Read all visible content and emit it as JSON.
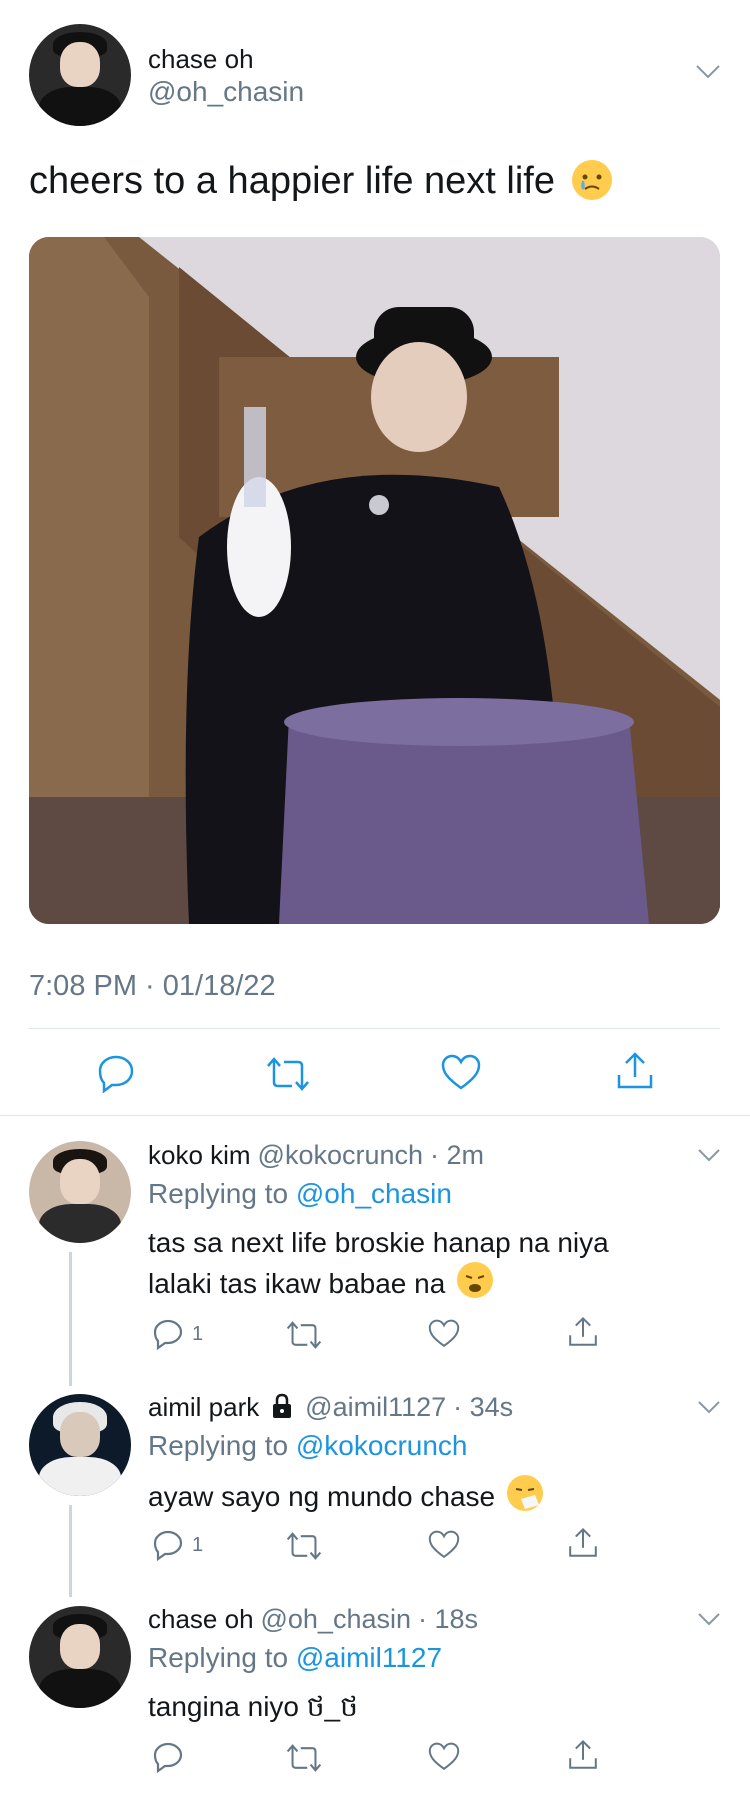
{
  "tweet": {
    "author_name": "chase oh",
    "author_handle": "@oh_chasin",
    "text": "cheers to a happier life next life",
    "timestamp": "7:08 PM · 01/18/22"
  },
  "replies": [
    {
      "name": "koko kim",
      "handle": "@kokocrunch",
      "time": "· 2m",
      "replying_prefix": "Replying to",
      "replying_to": "@oh_chasin",
      "text_line1": "tas sa next life broskie hanap na niya",
      "text_line2": "lalaki tas ikaw babae na",
      "reply_count": "1"
    },
    {
      "name": "aimil park",
      "handle": "@aimil1127",
      "time": "· 34s",
      "replying_prefix": "Replying to",
      "replying_to": "@kokocrunch",
      "text_line1": "ayaw sayo ng mundo chase",
      "reply_count": "1"
    },
    {
      "name": "chase oh",
      "handle": "@oh_chasin",
      "time": "· 18s",
      "replying_prefix": "Replying to",
      "replying_to": "@aimil1127",
      "text_line1": "tangina niyo ថ_ថ"
    }
  ],
  "colors": {
    "accent": "#1b95e0",
    "secondary_text": "#657786",
    "icon": "#1b95e0"
  }
}
